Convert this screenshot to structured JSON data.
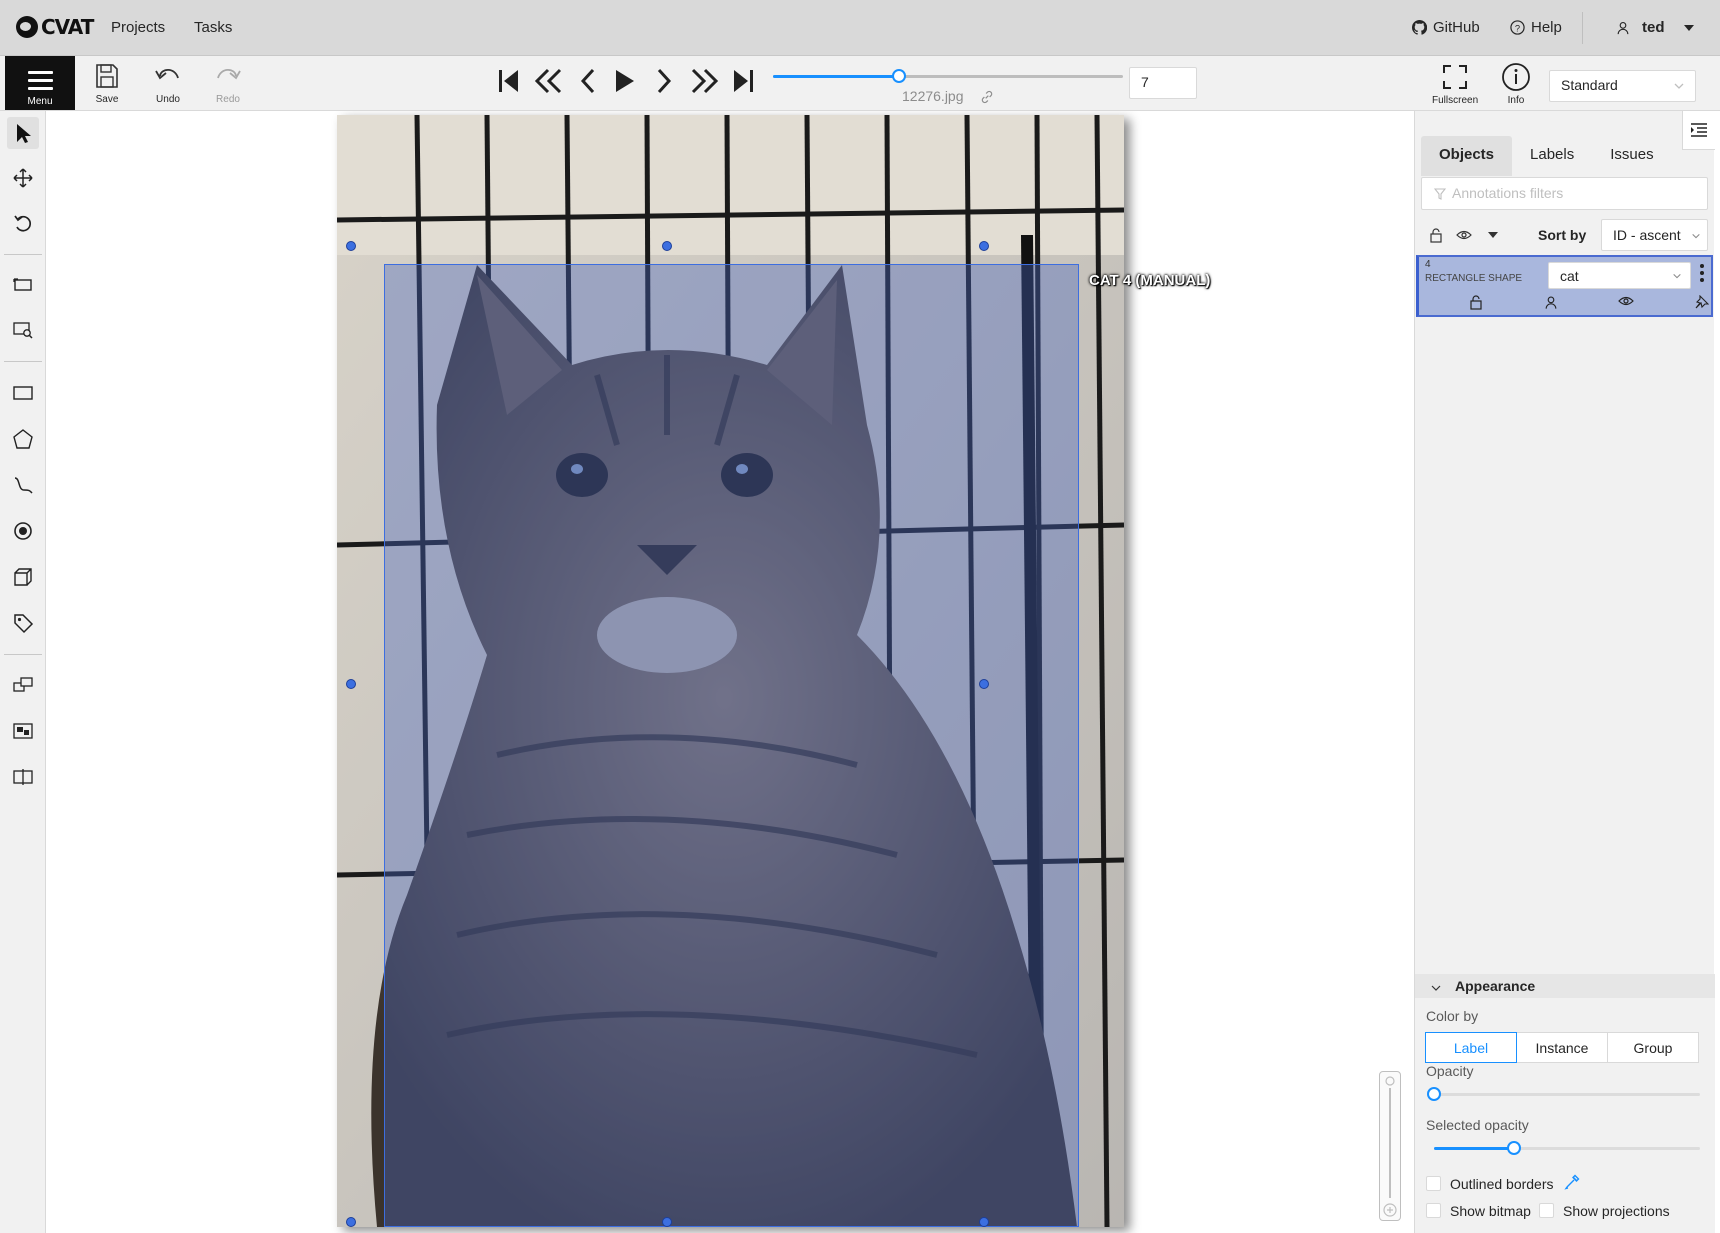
{
  "header": {
    "logo_text": "CVAT",
    "nav": [
      "Projects",
      "Tasks"
    ],
    "github": "GitHub",
    "help": "Help",
    "user": "ted"
  },
  "toolbar": {
    "menu_label": "Menu",
    "save_label": "Save",
    "undo_label": "Undo",
    "redo_label": "Redo",
    "frame_number": "7",
    "filename": "12276.jpg",
    "frame_progress": 0.36,
    "fullscreen_label": "Fullscreen",
    "info_label": "Info",
    "workspace": "Standard"
  },
  "canvas": {
    "object_label": "CAT 4 (MANUAL)"
  },
  "sidebar": {
    "tabs": [
      "Objects",
      "Labels",
      "Issues"
    ],
    "active_tab": "Objects",
    "filter_placeholder": "Annotations filters",
    "sort_label": "Sort by",
    "sort_value": "ID - ascent",
    "objects": [
      {
        "id": "4",
        "type": "RECTANGLE SHAPE",
        "label": "cat",
        "color": "#a9b7dd"
      }
    ],
    "appearance": {
      "title": "Appearance",
      "color_by_label": "Color by",
      "color_by_options": [
        "Label",
        "Instance",
        "Group"
      ],
      "color_by_selected": "Label",
      "opacity_label": "Opacity",
      "opacity_value": 0,
      "selected_opacity_label": "Selected opacity",
      "selected_opacity_value": 0.3,
      "outlined_borders_label": "Outlined borders",
      "show_bitmap_label": "Show bitmap",
      "show_projections_label": "Show projections"
    }
  },
  "colors": {
    "accent": "#1890ff",
    "selection_fill": "#4664be",
    "handle": "#3c6fe0"
  }
}
